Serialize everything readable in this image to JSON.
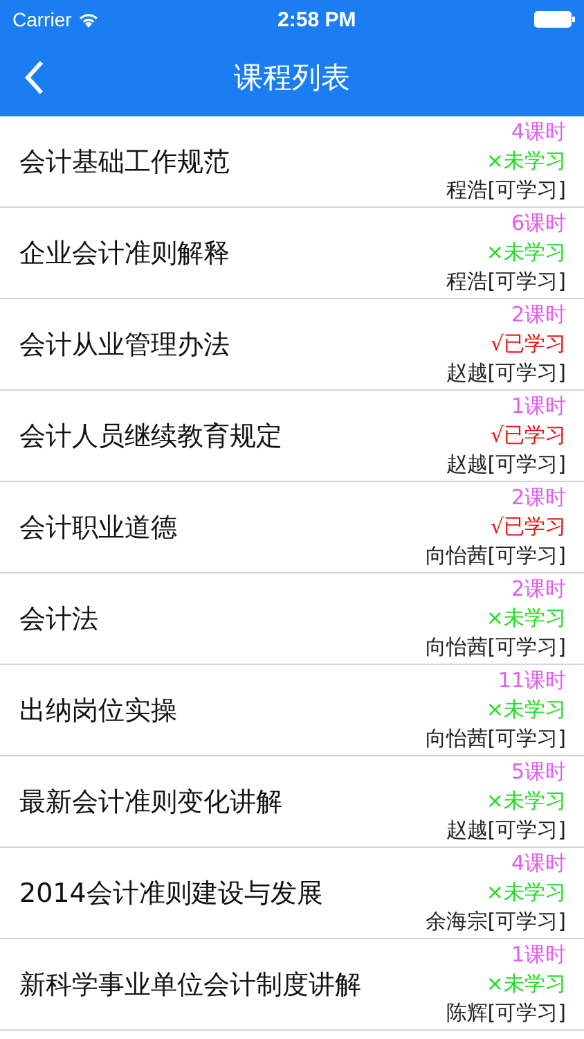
{
  "status_bar": {
    "carrier": "Carrier",
    "time": "2:58 PM"
  },
  "nav": {
    "title": "课程列表"
  },
  "courses": [
    {
      "title": "会计基础工作规范",
      "hours": "4课时",
      "status": "×未学习",
      "studied": false,
      "teacher": "程浩[可学习]"
    },
    {
      "title": "企业会计准则解释",
      "hours": "6课时",
      "status": "×未学习",
      "studied": false,
      "teacher": "程浩[可学习]"
    },
    {
      "title": "会计从业管理办法",
      "hours": "2课时",
      "status": "√已学习",
      "studied": true,
      "teacher": "赵越[可学习]"
    },
    {
      "title": "会计人员继续教育规定",
      "hours": "1课时",
      "status": "√已学习",
      "studied": true,
      "teacher": "赵越[可学习]"
    },
    {
      "title": "会计职业道德",
      "hours": "2课时",
      "status": "√已学习",
      "studied": true,
      "teacher": "向怡茜[可学习]"
    },
    {
      "title": "会计法",
      "hours": "2课时",
      "status": "×未学习",
      "studied": false,
      "teacher": "向怡茜[可学习]"
    },
    {
      "title": "出纳岗位实操",
      "hours": "11课时",
      "status": "×未学习",
      "studied": false,
      "teacher": "向怡茜[可学习]"
    },
    {
      "title": "最新会计准则变化讲解",
      "hours": "5课时",
      "status": "×未学习",
      "studied": false,
      "teacher": "赵越[可学习]"
    },
    {
      "title": "2014会计准则建设与发展",
      "hours": "4课时",
      "status": "×未学习",
      "studied": false,
      "teacher": "余海宗[可学习]"
    },
    {
      "title": "新科学事业单位会计制度讲解",
      "hours": "1课时",
      "status": "×未学习",
      "studied": false,
      "teacher": "陈辉[可学习]"
    }
  ]
}
